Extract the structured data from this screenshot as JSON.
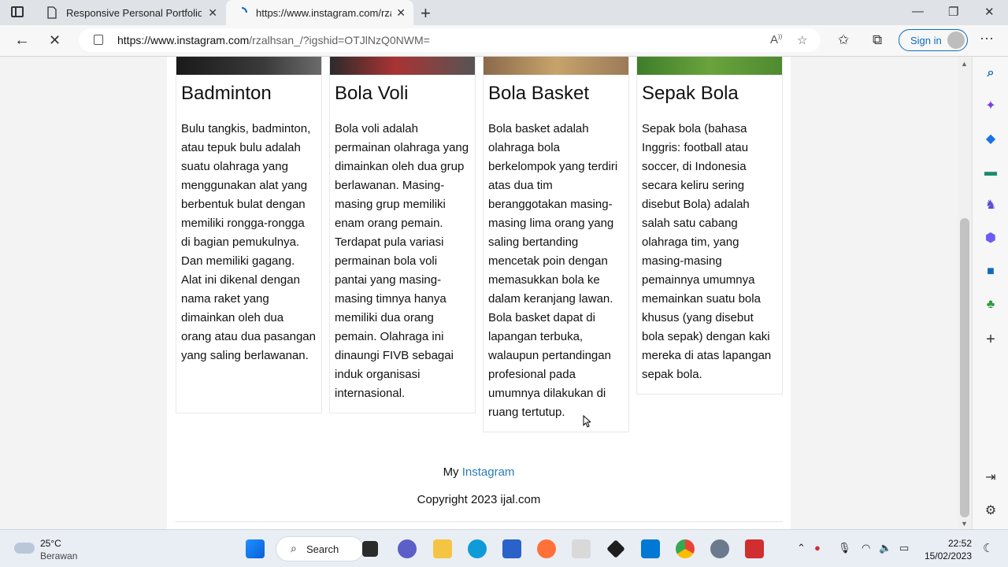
{
  "browser": {
    "tabs": [
      {
        "title": "Responsive Personal Portfolio We",
        "active": false
      },
      {
        "title": "https://www.instagram.com/rzalh",
        "active": true
      }
    ],
    "address": {
      "host": "https://www.instagram.com",
      "path": "/rzalhsan_/?igshid=OTJlNzQ0NWM="
    },
    "signin_label": "Sign in"
  },
  "page": {
    "cards": [
      {
        "title": "Badminton",
        "text": "Bulu tangkis, badminton, atau tepuk bulu adalah suatu olahraga yang menggunakan alat yang berbentuk bulat dengan memiliki rongga-rongga di bagian pemukulnya. Dan memiliki gagang. Alat ini dikenal dengan nama raket yang dimainkan oleh dua orang atau dua pasangan yang saling berlawanan."
      },
      {
        "title": "Bola Voli",
        "text": "Bola voli adalah permainan olahraga yang dimainkan oleh dua grup berlawanan. Masing-masing grup memiliki enam orang pemain. Terdapat pula variasi permainan bola voli pantai yang masing-masing timnya hanya memiliki dua orang pemain. Olahraga ini dinaungi FIVB sebagai induk organisasi internasional."
      },
      {
        "title": "Bola Basket",
        "text": "Bola basket adalah olahraga bola berkelompok yang terdiri atas dua tim beranggotakan masing-masing lima orang yang saling bertanding mencetak poin dengan memasukkan bola ke dalam keranjang lawan. Bola basket dapat di lapangan terbuka, walaupun pertandingan profesional pada umumnya dilakukan di ruang tertutup."
      },
      {
        "title": "Sepak Bola",
        "text": "Sepak bola (bahasa Inggris: football atau soccer, di Indonesia secara keliru sering disebut Bola) adalah salah satu cabang olahraga tim, yang masing-masing pemainnya umumnya memainkan suatu bola khusus (yang disebut bola sepak) dengan kaki mereka di atas lapangan sepak bola."
      }
    ],
    "footer": {
      "prefix": "My",
      "link_label": "Instagram",
      "copyright": "Copyright 2023 ijal.com"
    }
  },
  "taskbar": {
    "weather": {
      "temp": "25°C",
      "condition": "Berawan"
    },
    "search_label": "Search",
    "clock": {
      "time": "22:52",
      "date": "15/02/2023"
    }
  },
  "colors": {
    "link": "#2b7bb9",
    "accent": "#0f6cbd",
    "text": "#111111"
  }
}
